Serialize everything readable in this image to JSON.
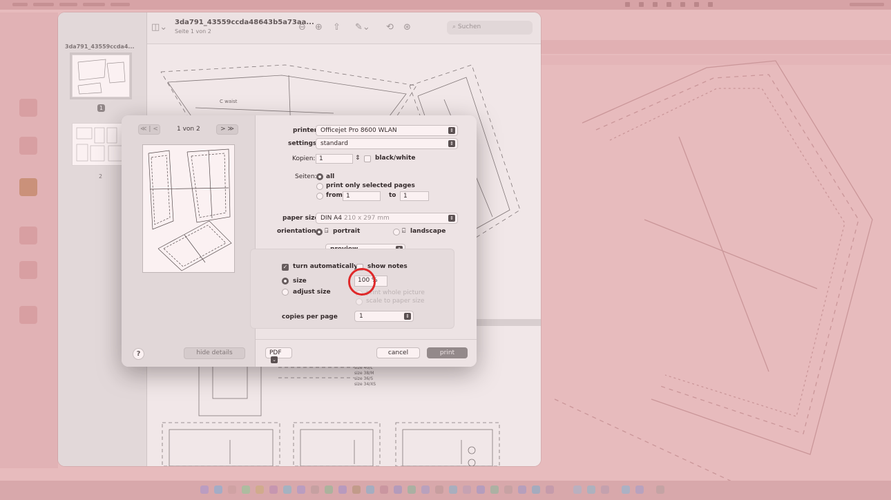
{
  "app": {
    "title": "3da791_43559ccda48643b5a73aa...",
    "subtitle": "Seite 1 von 2",
    "search_placeholder": "Suchen",
    "sidebar_filename": "3da791_43559ccda4...",
    "page_badge": "1",
    "page_two_label": "2"
  },
  "print_dialog": {
    "page_nav": "1 von 2",
    "nav_first_prev": "≪ |  <",
    "nav_next_last": ">  ≫",
    "printer_label": "printer",
    "printer_value": "Officejet Pro 8600 WLAN",
    "settings_label": "settings",
    "settings_value": "standard",
    "copies_label": "Kopien:",
    "copies_value": "1",
    "bw_label": "black/white",
    "pages_label": "Seiten:",
    "pages_all": "all",
    "pages_selected": "print only selected pages",
    "pages_from": "from",
    "from_value": "1",
    "pages_to": "to",
    "to_value": "1",
    "paper_size_label": "paper size",
    "paper_size_value": "DIN A4",
    "paper_size_dims": "210 x 297 mm",
    "orientation_label": "orientation",
    "orientation_portrait": "portrait",
    "orientation_landscape": "landscape",
    "section_popup": "preview",
    "turn_automatically": "turn automatically",
    "show_notes": "show notes",
    "size_label": "size",
    "size_value": "100 %",
    "adjust_size": "adjust size",
    "print_whole_picture": "print whole picture",
    "scale_to_paper": "scale to paper size",
    "copies_per_page_label": "copies per page",
    "copies_per_page_value": "1",
    "help": "?",
    "hide_details": "hide details",
    "pdf": "PDF",
    "cancel": "cancel",
    "print": "print"
  },
  "document": {
    "pattern_label_waist": "C waist",
    "size_legend": [
      "size 40/L",
      "size 38/M",
      "size 36/S",
      "size 34/XS"
    ]
  },
  "colors": {
    "tint": "#e9c3c4",
    "highlight": "#e02020",
    "print_button": "#8c8c8c"
  },
  "icons": {
    "sidebar_toggle": "sidebar-icon",
    "zoom_out": "zoom-out-icon",
    "zoom_in": "zoom-in-icon",
    "share": "share-icon",
    "markup": "markup-pen-icon",
    "rotate": "rotate-icon",
    "annotate": "annotate-icon",
    "search": "search-icon"
  }
}
